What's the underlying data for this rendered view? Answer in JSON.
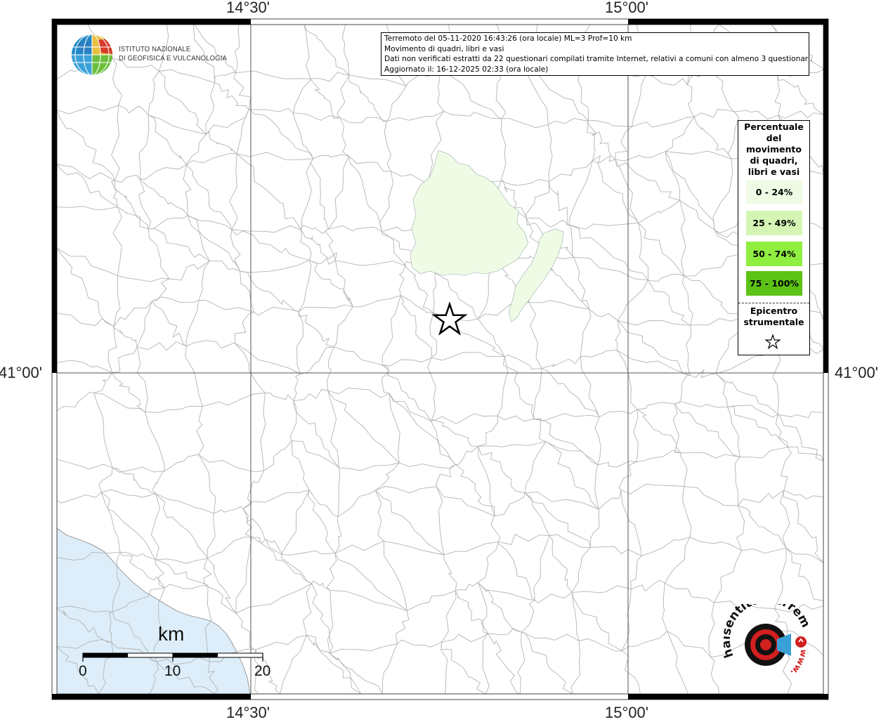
{
  "map": {
    "lon_labels": [
      "14°30'",
      "15°00'"
    ],
    "lat_labels": [
      "41°00'",
      "41°00'"
    ]
  },
  "info": {
    "line1": "Terremoto del 05-11-2020 16:43:26 (ora locale) ML=3 Prof=10 km",
    "line2": "Movimento di quadri, libri e vasi",
    "line3": "Dati non verificati estratti da 22 questionari compilati tramite Internet, relativi a comuni con almeno 3 questionari.",
    "line4": "Aggiornato il: 16-12-2025 02:33 (ora locale)"
  },
  "legend": {
    "title_lines": [
      "Percentuale",
      "del",
      "movimento",
      "di quadri,",
      "libri e vasi"
    ],
    "classes": [
      {
        "label": "0 - 24%",
        "color": "#f0fbe6"
      },
      {
        "label": "25 - 49%",
        "color": "#d4f5b4"
      },
      {
        "label": "50 - 74%",
        "color": "#90ee40"
      },
      {
        "label": "75 - 100%",
        "color": "#5cc316"
      }
    ],
    "epicenter_lines": [
      "Epicentro",
      "strumentale"
    ]
  },
  "logo": {
    "line1": "ISTITUTO NAZIONALE",
    "line2": "DI GEOFISICA E VULCANOLOGIA"
  },
  "scale": {
    "unit": "km",
    "ticks": [
      "0",
      "10",
      "20"
    ]
  },
  "hs_logo": {
    "text": "haisentitoilterremoto.it",
    "url": "www.",
    "accent_color": "#d21f1f"
  },
  "colors": {
    "sea": "#ddeefa",
    "affected_area": "#f0fbe6",
    "border_lines": "#b4b4b4"
  }
}
